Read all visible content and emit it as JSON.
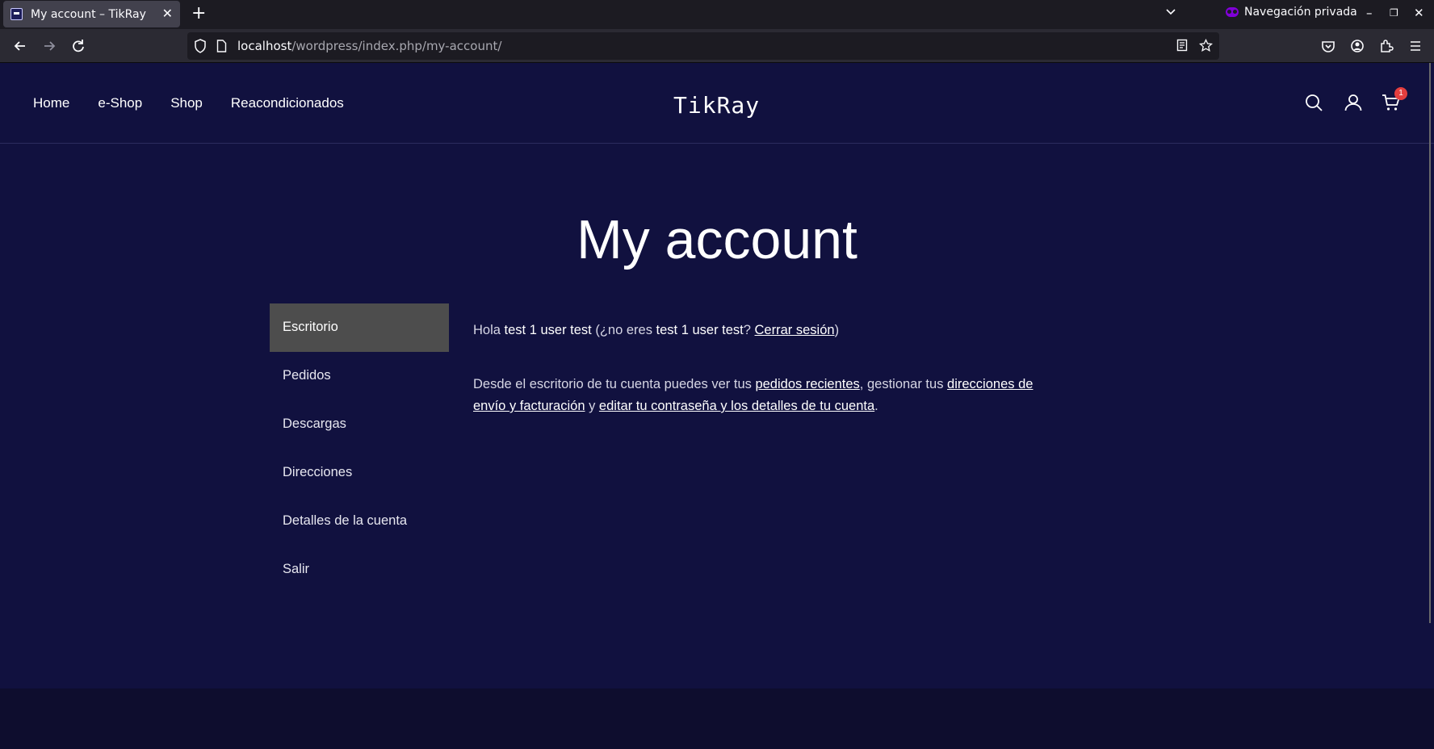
{
  "browser": {
    "tab_title": "My account – TikRay",
    "private_label": "Navegación privada",
    "url_host": "localhost",
    "url_path": "/wordpress/index.php/my-account/"
  },
  "site": {
    "menu": [
      "Home",
      "e-Shop",
      "Shop",
      "Reacondicionados"
    ],
    "logo": "TikRay",
    "cart_count": "1"
  },
  "page": {
    "title": "My account"
  },
  "account_nav": {
    "items": [
      "Escritorio",
      "Pedidos",
      "Descargas",
      "Direcciones",
      "Detalles de la cuenta",
      "Salir"
    ],
    "active": "Escritorio"
  },
  "dashboard": {
    "greeting_prefix": "Hola ",
    "user_name": "test 1 user test",
    "greeting_mid": " (¿no eres ",
    "user_name_2": "test 1 user test",
    "greeting_q": "? ",
    "logout_link": "Cerrar sesión",
    "greeting_end": ")",
    "desc_1": "Desde el escritorio de tu cuenta puedes ver tus ",
    "link_orders": "pedidos recientes",
    "desc_2": ", gestionar tus ",
    "link_addresses": "direcciones de envío y facturación",
    "desc_3": " y ",
    "link_account": "editar tu contraseña y los detalles de tu cuenta",
    "desc_4": "."
  },
  "colors": {
    "page_bg": "#11113f",
    "active_nav_bg": "#4d4d4d",
    "badge": "#e53e3e"
  }
}
